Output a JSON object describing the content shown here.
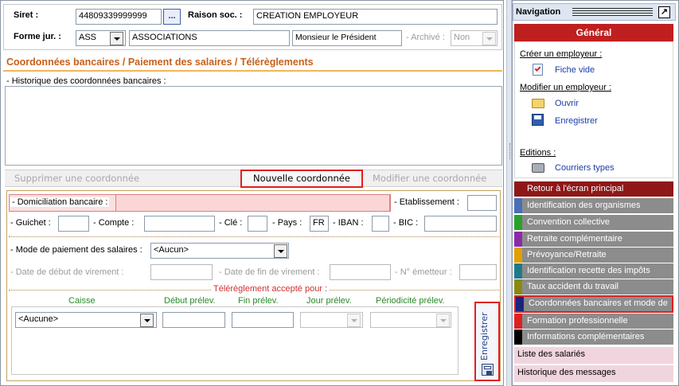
{
  "header": {
    "siret_label": "Siret :",
    "siret_value": "44809339999999",
    "browse_label": "...",
    "raison_label": "Raison soc. :",
    "raison_value": "CREATION EMPLOYEUR",
    "forme_label": "Forme jur. :",
    "forme_code": "ASS",
    "forme_text": "ASSOCIATIONS",
    "civilite_value": "Monsieur le Président",
    "archive_label": "- Archivé :",
    "archive_value": "Non"
  },
  "section_title": "Coordonnées bancaires / Paiement des salaires / Télérèglements",
  "history_label": "- Historique des coordonnées bancaires :",
  "actions": {
    "delete": "Supprimer une coordonnée",
    "new": "Nouvelle coordonnée",
    "modify": "Modifier une coordonnée"
  },
  "form": {
    "domiciliation_label": "- Domiciliation bancaire :",
    "etablissement_label": "- Etablissement :",
    "guichet_label": "- Guichet :",
    "compte_label": "- Compte :",
    "cle_label": "- Clé :",
    "pays_label": "- Pays :",
    "pays_value": "FR",
    "iban_label": "- IBAN :",
    "bic_label": "- BIC :",
    "mode_label": "- Mode de paiement des salaires :",
    "mode_value": "<Aucun>",
    "date_debut_label": "- Date de début de virement :",
    "date_fin_label": "- Date de fin de virement :",
    "emetteur_label": "- N° émetteur :",
    "telereglement_label": "Télérèglement accepté pour :",
    "columns": [
      "Caisse",
      "Début prélev.",
      "Fin prélev.",
      "Jour prélev.",
      "Périodicité prélev."
    ],
    "caisse_value": "<Aucune>",
    "save_label": "Enregistrer"
  },
  "navigation": {
    "title": "Navigation",
    "group_title": "Général",
    "create_heading": "Créer un employeur :",
    "fiche_vide": "Fiche vide",
    "modify_heading": "Modifier un employeur :",
    "ouvrir": "Ouvrir",
    "enregistrer": "Enregistrer",
    "editions_heading": "Editions :",
    "courriers": "Courriers types",
    "items": [
      {
        "label": "Retour à l'écran principal",
        "color": "#9b1a1a"
      },
      {
        "label": "Identification des organismes",
        "color": "#4a6fb5"
      },
      {
        "label": "Convention collective",
        "color": "#2aa02a"
      },
      {
        "label": "Retraite complémentaire",
        "color": "#8a2aa8"
      },
      {
        "label": "Prévoyance/Retraite",
        "color": "#e0a000"
      },
      {
        "label": "Identification recette des impôts",
        "color": "#1e7a8a"
      },
      {
        "label": "Taux accident du travail",
        "color": "#8a8a10"
      },
      {
        "label": "Coordonnées bancaires et mode de",
        "color": "#1a237e"
      },
      {
        "label": "Formation professionnelle",
        "color": "#e02020"
      },
      {
        "label": "Informations complémentaires",
        "color": "#000000"
      }
    ],
    "bottom1": "Liste des salariés",
    "bottom2": "Historique des messages"
  }
}
